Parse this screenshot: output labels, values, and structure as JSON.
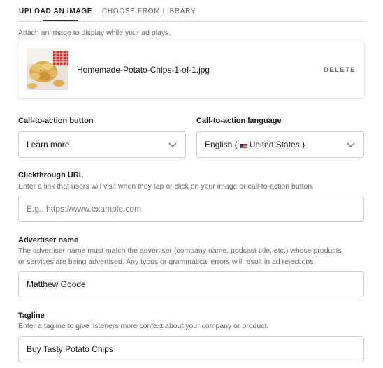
{
  "tabs": {
    "upload": "UPLOAD AN IMAGE",
    "library": "CHOOSE FROM LIBRARY"
  },
  "upload": {
    "hint": "Attach an image to display while your ad plays.",
    "file_name": "Homemade-Potato-Chips-1-of-1.jpg",
    "delete_label": "DELETE"
  },
  "cta_button": {
    "label": "Call-to-action button",
    "value": "Learn more"
  },
  "cta_language": {
    "label": "Call-to-action language",
    "value_prefix": "English (",
    "value_country": "United States )",
    "flag_icon": "us-flag-icon"
  },
  "clickthrough": {
    "label": "Clickthrough URL",
    "hint": "Enter a link that users will visit when they tap or click on your image or call-to-action button.",
    "placeholder": "E.g., https://www.example.com",
    "value": ""
  },
  "advertiser": {
    "label": "Advertiser name",
    "hint_line1": "The advertiser name must match the advertiser (company name, podcast title, etc.) whose products",
    "hint_line2": "or services are being advertised. Any typos or grammatical errors will result in ad rejections.",
    "value": "Matthew Goode"
  },
  "tagline": {
    "label": "Tagline",
    "hint": "Enter a tagline to give listeners more context about your company or product.",
    "value": "Buy Tasty Potato Chips"
  },
  "colors": {
    "text": "#181818",
    "muted": "#6a6a6a",
    "border": "#cfcfcf"
  }
}
